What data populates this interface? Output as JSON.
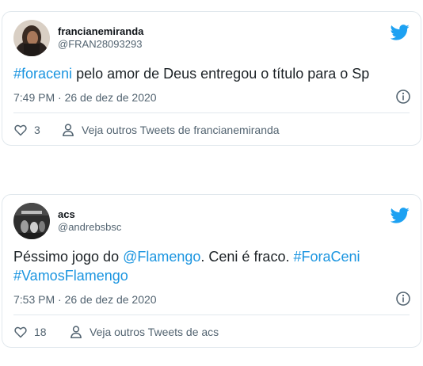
{
  "tweets": [
    {
      "display_name": "francianemiranda",
      "handle": "@FRAN28093293",
      "text": [
        {
          "type": "hashtag",
          "value": "#foraceni"
        },
        {
          "type": "text",
          "value": " pelo amor de Deus entregou o título para o Sp"
        }
      ],
      "timestamp": "7:49 PM · 26 de dez de 2020",
      "likes": "3",
      "profile_link": "Veja outros Tweets de francianemiranda"
    },
    {
      "display_name": "acs",
      "handle": "@andrebsbsc",
      "text": [
        {
          "type": "text",
          "value": "Péssimo jogo do "
        },
        {
          "type": "mention",
          "value": "@Flamengo"
        },
        {
          "type": "text",
          "value": ". Ceni é fraco. "
        },
        {
          "type": "hashtag",
          "value": "#ForaCeni"
        },
        {
          "type": "hashtag",
          "value": "#VamosFlamengo"
        }
      ],
      "timestamp": "7:53 PM · 26 de dez de 2020",
      "likes": "18",
      "profile_link": "Veja outros Tweets de acs"
    }
  ],
  "icons": {
    "brand": "twitter-bird-icon",
    "info": "info-icon",
    "like": "heart-icon",
    "profile": "person-icon"
  },
  "colors": {
    "brand_blue": "#1da1f2",
    "link_blue": "#1b95e0",
    "secondary_text": "#536471",
    "border": "#e1e8ed"
  }
}
